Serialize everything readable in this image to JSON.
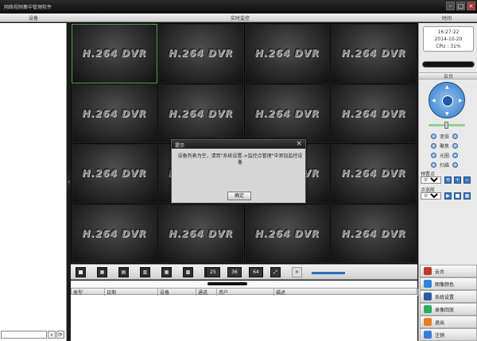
{
  "window": {
    "title": "网络视频集中管理软件"
  },
  "header": {
    "devices": "设备",
    "live": "实时监控",
    "time": "时间"
  },
  "grid": {
    "label": "H.264 DVR",
    "cells": 16
  },
  "dialog": {
    "title": "提示",
    "message": "设备列表为空，请到\"系统设置->监控点管理\"中添加监控设备",
    "ok": "确定"
  },
  "clock": {
    "time": "16:27:22",
    "date": "2014-10-20",
    "cpu": "CPU : 31%"
  },
  "ptz": {
    "label": "云台",
    "focus": "变倍",
    "zoom": "聚焦",
    "iris": "光圈",
    "scan": "扫描",
    "preset_label": "预置点",
    "preset_value": "01",
    "cruise_label": "点巡航",
    "cruise_value": "01"
  },
  "toolbar": {
    "layout25": "25",
    "layout36": "36",
    "layout64": "64"
  },
  "log": {
    "cols": [
      "类型",
      "日期",
      "设备",
      "通道",
      "用户",
      "描述"
    ]
  },
  "functions": [
    {
      "label": "云台",
      "icon": "ptz-icon",
      "color": "#c0392b"
    },
    {
      "label": "图像颜色",
      "icon": "palette-icon",
      "color": "#2e86de"
    },
    {
      "label": "系统设置",
      "icon": "settings-icon",
      "color": "#2c5aa0"
    },
    {
      "label": "录像回放",
      "icon": "playback-icon",
      "color": "#27ae60"
    },
    {
      "label": "退出",
      "icon": "exit-icon",
      "color": "#e67e22"
    },
    {
      "label": "注销",
      "icon": "logout-icon",
      "color": "#3a7bd5"
    }
  ]
}
